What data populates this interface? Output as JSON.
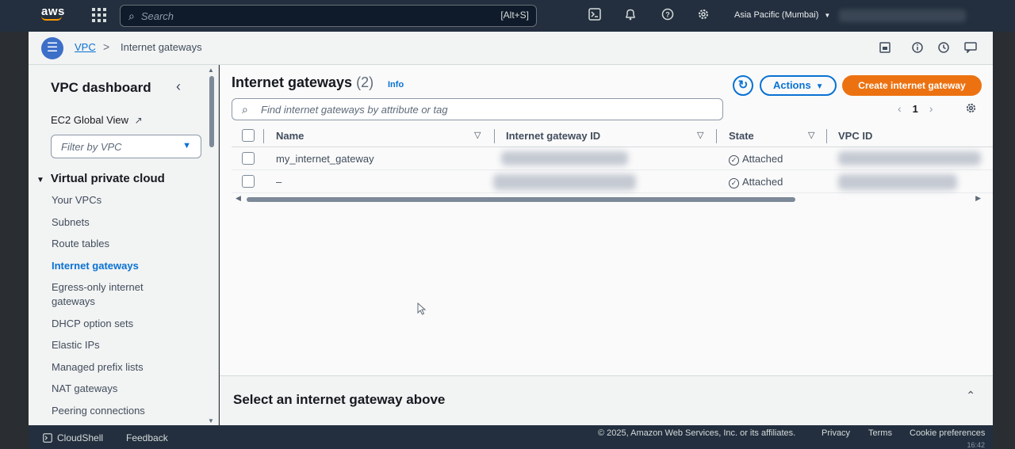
{
  "topnav": {
    "brand": "aws",
    "search_placeholder": "Search",
    "search_shortcut": "[Alt+S]",
    "icons": [
      "cloudshell-icon",
      "bell-icon",
      "help-icon",
      "settings-icon"
    ],
    "region": "Asia Pacific (Mumbai)"
  },
  "breadcrumb": {
    "service": "VPC",
    "separator": ">",
    "current": "Internet gateways"
  },
  "sidebar": {
    "title": "VPC dashboard",
    "global_view": "EC2 Global View",
    "filter_placeholder": "Filter by VPC",
    "section": "Virtual private cloud",
    "items": [
      {
        "label": "Your VPCs"
      },
      {
        "label": "Subnets"
      },
      {
        "label": "Route tables"
      },
      {
        "label": "Internet gateways",
        "active": true
      },
      {
        "label": "Egress-only internet gateways"
      },
      {
        "label": "DHCP option sets"
      },
      {
        "label": "Elastic IPs"
      },
      {
        "label": "Managed prefix lists"
      },
      {
        "label": "NAT gateways"
      },
      {
        "label": "Peering connections"
      }
    ]
  },
  "main": {
    "title": "Internet gateways",
    "count": "(2)",
    "info": "Info",
    "actions_label": "Actions",
    "create_label": "Create internet gateway",
    "find_placeholder": "Find internet gateways by attribute or tag",
    "page_number": "1",
    "columns": [
      "Name",
      "Internet gateway ID",
      "State",
      "VPC ID"
    ],
    "rows": [
      {
        "name": "my_internet_gateway",
        "state": "Attached"
      },
      {
        "name": "–",
        "state": "Attached"
      }
    ],
    "split_panel_title": "Select an internet gateway above"
  },
  "footer": {
    "cloudshell": "CloudShell",
    "feedback": "Feedback",
    "copyright": "© 2025, Amazon Web Services, Inc. or its affiliates.",
    "privacy": "Privacy",
    "terms": "Terms",
    "cookie": "Cookie preferences",
    "time": "16:42"
  },
  "colors": {
    "nav_bg": "#232f3e",
    "link": "#0972d3",
    "primary_button": "#ec7211",
    "page_bg": "#fafafa"
  }
}
